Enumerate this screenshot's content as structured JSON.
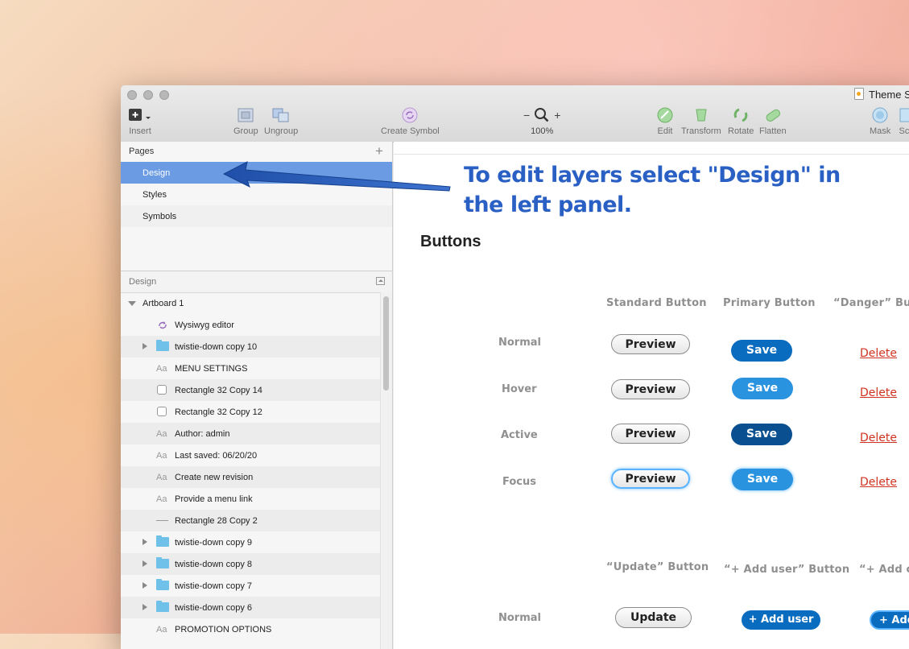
{
  "window": {
    "title": "Theme S"
  },
  "toolbar": {
    "insert": "Insert",
    "group": "Group",
    "ungroup": "Ungroup",
    "create_symbol": "Create Symbol",
    "zoom_minus": "−",
    "zoom_plus": "+",
    "zoom_level": "100%",
    "edit": "Edit",
    "transform": "Transform",
    "rotate": "Rotate",
    "flatten": "Flatten",
    "mask": "Mask",
    "scale": "Sca"
  },
  "pages": {
    "header": "Pages",
    "add": "+",
    "items": [
      {
        "label": "Design",
        "selected": true
      },
      {
        "label": "Styles"
      },
      {
        "label": "Symbols"
      }
    ]
  },
  "layers": {
    "header": "Design",
    "artboard": "Artboard 1",
    "items": [
      {
        "label": "Wysiwyg editor",
        "icon": "symbol-icon"
      },
      {
        "label": "twistie-down copy 10",
        "icon": "folder-icon",
        "expandable": true
      },
      {
        "label": "MENU SETTINGS",
        "icon": "text-icon"
      },
      {
        "label": "Rectangle 32 Copy 14",
        "icon": "rectangle-icon"
      },
      {
        "label": "Rectangle 32 Copy 12",
        "icon": "rectangle-icon"
      },
      {
        "label": "Author: admin",
        "icon": "text-icon"
      },
      {
        "label": "Last saved: 06/20/20",
        "icon": "text-icon"
      },
      {
        "label": "Create new revision",
        "icon": "text-icon"
      },
      {
        "label": "Provide a menu link",
        "icon": "text-icon"
      },
      {
        "label": "Rectangle 28 Copy 2",
        "icon": "line-icon"
      },
      {
        "label": "twistie-down copy 9",
        "icon": "folder-icon",
        "expandable": true
      },
      {
        "label": "twistie-down copy 8",
        "icon": "folder-icon",
        "expandable": true
      },
      {
        "label": "twistie-down copy 7",
        "icon": "folder-icon",
        "expandable": true
      },
      {
        "label": "twistie-down copy 6",
        "icon": "folder-icon",
        "expandable": true
      },
      {
        "label": "PROMOTION OPTIONS",
        "icon": "text-icon"
      }
    ],
    "text_icon_glyph": "Aa"
  },
  "canvas": {
    "annotation_line1": "To edit layers select \"Design\" in",
    "annotation_line2": "the left panel.",
    "section_title": "Buttons",
    "columns": {
      "standard": "Standard Button",
      "primary": "Primary Button",
      "danger": "“Danger” Butto"
    },
    "states": {
      "normal": "Normal",
      "hover": "Hover",
      "active": "Active",
      "focus": "Focus"
    },
    "preview": "Preview",
    "save": "Save",
    "delete": "Delete",
    "columns2": {
      "update": "“Update” Button",
      "add_user": "“+ Add user” Button",
      "add_other": "“+ Add co"
    },
    "normal2": "Normal",
    "update": "Update",
    "add_user": "+ Add user",
    "add_other": "+ Add"
  },
  "colors": {
    "selection": "#6b9be3",
    "primary": "#0a6cbf",
    "danger": "#d0331f",
    "annotation": "#2a60c4"
  }
}
